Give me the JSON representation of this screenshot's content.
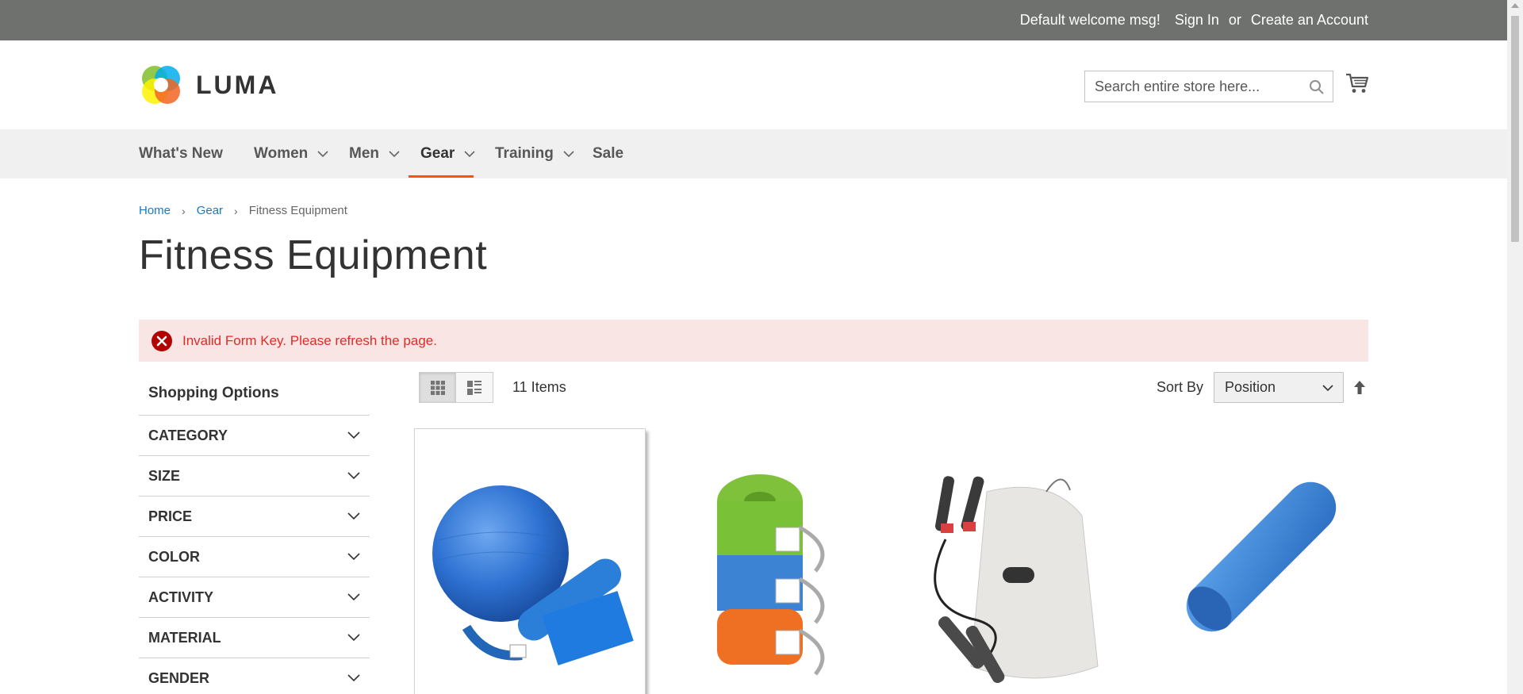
{
  "header": {
    "welcome": "Default welcome msg!",
    "sign_in": "Sign In",
    "or": "or",
    "create_account": "Create an Account",
    "logo_text": "LUMA",
    "search_placeholder": "Search entire store here..."
  },
  "nav": {
    "items": [
      {
        "label": "What's New"
      },
      {
        "label": "Women"
      },
      {
        "label": "Men"
      },
      {
        "label": "Gear"
      },
      {
        "label": "Training"
      },
      {
        "label": "Sale"
      }
    ],
    "active": "Gear"
  },
  "breadcrumb": {
    "home": "Home",
    "gear": "Gear",
    "current": "Fitness Equipment"
  },
  "page_title": "Fitness Equipment",
  "error_message": "Invalid Form Key. Please refresh the page.",
  "sidebar": {
    "title": "Shopping Options",
    "filters": [
      "CATEGORY",
      "SIZE",
      "PRICE",
      "COLOR",
      "ACTIVITY",
      "MATERIAL",
      "GENDER"
    ]
  },
  "toolbar": {
    "items_count": "11 Items",
    "sort_by_label": "Sort By",
    "sort_value": "Position"
  },
  "products": [
    {
      "image": "fitness-ball-kit"
    },
    {
      "image": "yoga-straps"
    },
    {
      "image": "jump-rope-bag"
    },
    {
      "image": "foam-roller"
    }
  ],
  "colors": {
    "top_bar": "#6e716e",
    "nav_bg": "#f0f0f0",
    "nav_active_underline": "#ff5501",
    "link": "#1979c3",
    "error_bg": "#fae5e5",
    "error_text": "#e02b27"
  }
}
